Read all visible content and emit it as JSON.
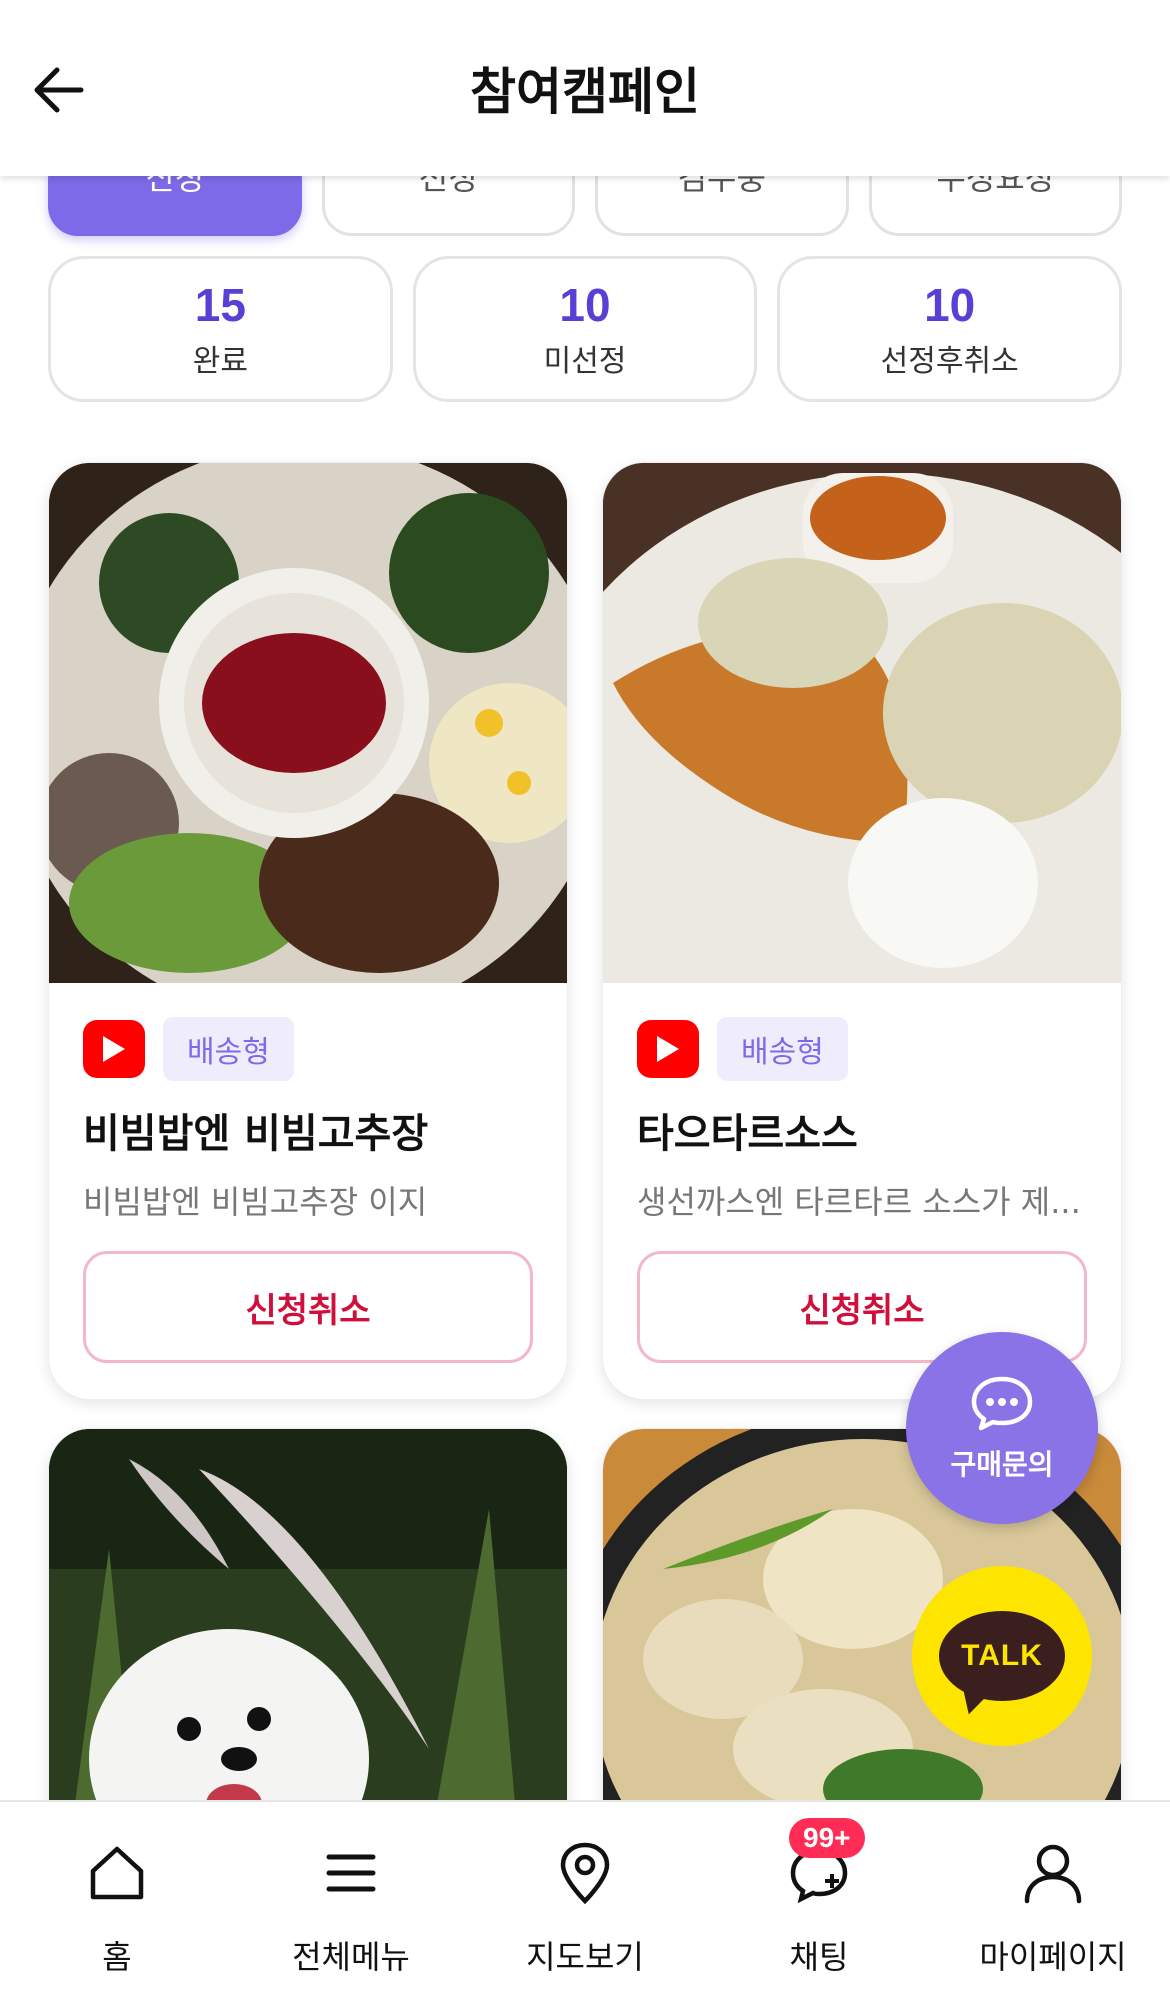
{
  "header": {
    "title": "참여캠페인"
  },
  "tabs": [
    {
      "label": "신청",
      "active": true
    },
    {
      "label": "선정",
      "active": false
    },
    {
      "label": "검수중",
      "active": false
    },
    {
      "label": "수정요청",
      "active": false
    }
  ],
  "counts": [
    {
      "value": "15",
      "label": "완료"
    },
    {
      "value": "10",
      "label": "미선정"
    },
    {
      "value": "10",
      "label": "선정후취소"
    }
  ],
  "campaigns": [
    {
      "platform_icon": "youtube-icon",
      "tag": "배송형",
      "title": "비빔밥엔 비빔고추장",
      "desc": "비빔밥엔 비빔고추장 이지",
      "button": "신청취소"
    },
    {
      "platform_icon": "youtube-icon",
      "tag": "배송형",
      "title": "타으타르소스",
      "desc": "생선까스엔 타르타르 소스가 제...",
      "button": "신청취소"
    }
  ],
  "floating": {
    "inquiry_label": "구매문의",
    "talk_label": "TALK"
  },
  "nav": [
    {
      "label": "홈",
      "icon": "home-icon"
    },
    {
      "label": "전체메뉴",
      "icon": "menu-icon"
    },
    {
      "label": "지도보기",
      "icon": "map-pin-icon"
    },
    {
      "label": "채팅",
      "icon": "chat-icon",
      "badge": "99+"
    },
    {
      "label": "마이페이지",
      "icon": "user-icon"
    }
  ],
  "colors": {
    "accent": "#7d6ae8",
    "count": "#5a3fd6",
    "cancel": "#d0103a",
    "talk": "#fee500",
    "badge": "#ff2d55"
  }
}
